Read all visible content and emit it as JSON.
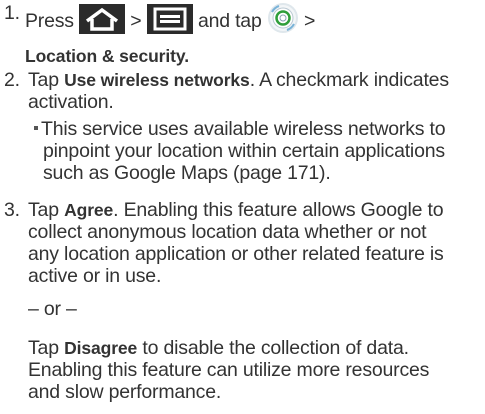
{
  "step1": {
    "number": "1.",
    "press": "Press",
    "sep1": ">",
    "sep2": ">",
    "and_tap": "and tap",
    "sep3": ">",
    "target": "Location & security",
    "period": ".",
    "icons": [
      "home-icon",
      "menu-icon",
      "settings-icon"
    ],
    "colors": {
      "icon_bg": "#2b2b2b",
      "icon_fg": "#ffffff",
      "settings_accent": "#cfe3f0"
    }
  },
  "step2": {
    "number": "2.",
    "tap": "Tap",
    "option": "Use wireless networks",
    "rest_line1": ". A checkmark indicates",
    "rest_line2": "activation.",
    "bullet_lines": [
      "This service uses available wireless networks to",
      "pinpoint your location within certain applications",
      "such as Google Maps (page 171)."
    ]
  },
  "step3": {
    "number": "3.",
    "tap": "Tap",
    "agree": "Agree",
    "agree_rest_line1": ". Enabling this feature allows Google to",
    "agree_lines": [
      "collect anonymous location data whether or not",
      "any location application or other related feature is",
      "active or in use."
    ],
    "or": "– or –",
    "tap2": "Tap",
    "disagree": "Disagree",
    "disagree_rest_line1": " to disable the collection of data.",
    "disagree_lines": [
      "Enabling this feature can utilize more resources",
      "and slow performance."
    ]
  }
}
